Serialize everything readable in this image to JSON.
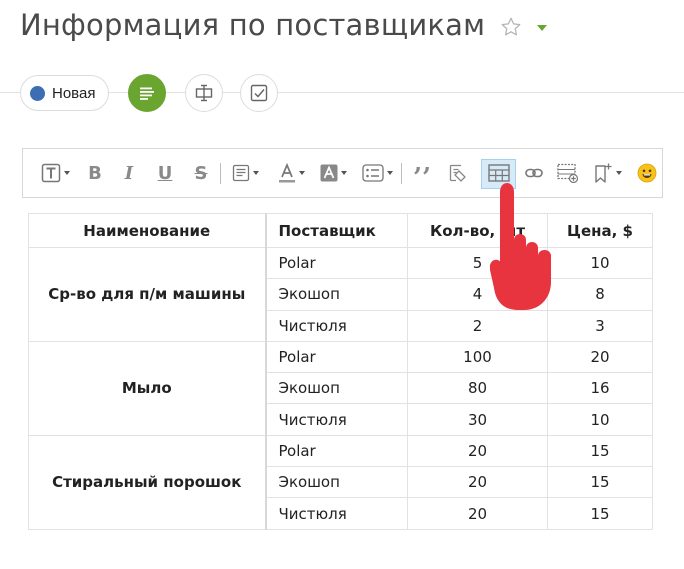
{
  "page": {
    "title": "Информация по поставщикам",
    "icons": {
      "star": "star-outline-icon",
      "caret": "chevron-down-icon"
    },
    "accent_color": "#6aa530"
  },
  "status": {
    "label": "Новая",
    "dot_color": "#3d6eb3"
  },
  "actions": [
    {
      "name": "text-view-button",
      "icon": "lines-icon",
      "active": true
    },
    {
      "name": "structure-button",
      "icon": "split-box-icon",
      "active": false
    },
    {
      "name": "checklist-button",
      "icon": "checkbox-icon",
      "active": false
    }
  ],
  "toolbar": {
    "text_style": "T",
    "bold": "B",
    "italic": "I",
    "underline": "U",
    "strike": "S",
    "quote": "’’",
    "emoji": "😀",
    "icons": [
      "text-style-icon",
      "bold-icon",
      "italic-icon",
      "underline-icon",
      "strikethrough-icon",
      "paragraph-icon",
      "font-color-icon",
      "background-color-icon",
      "list-icon",
      "quote-icon",
      "clear-format-icon",
      "table-icon",
      "link-icon",
      "insert-table-row-icon",
      "bookmark-icon",
      "emoji-icon"
    ],
    "active_item": "table-icon"
  },
  "table": {
    "headers": [
      "Наименование",
      "Поставщик",
      "Кол-во, шт",
      "Цена, $"
    ],
    "groups": [
      {
        "name": "Ср-во для п/м машины",
        "rows": [
          {
            "supplier": "Polar",
            "qty": "5",
            "price": "10"
          },
          {
            "supplier": "Экошоп",
            "qty": "4",
            "price": "8"
          },
          {
            "supplier": "Чистюля",
            "qty": "2",
            "price": "3"
          }
        ]
      },
      {
        "name": "Мыло",
        "rows": [
          {
            "supplier": "Polar",
            "qty": "100",
            "price": "20"
          },
          {
            "supplier": "Экошоп",
            "qty": "80",
            "price": "16"
          },
          {
            "supplier": "Чистюля",
            "qty": "30",
            "price": "10"
          }
        ]
      },
      {
        "name": "Стиральный порошок",
        "rows": [
          {
            "supplier": "Polar",
            "qty": "20",
            "price": "15"
          },
          {
            "supplier": "Экошоп",
            "qty": "20",
            "price": "15"
          },
          {
            "supplier": "Чистюля",
            "qty": "20",
            "price": "15"
          }
        ]
      }
    ]
  },
  "pointer": {
    "icon": "hand-pointer-icon",
    "color": "#e8343f"
  }
}
